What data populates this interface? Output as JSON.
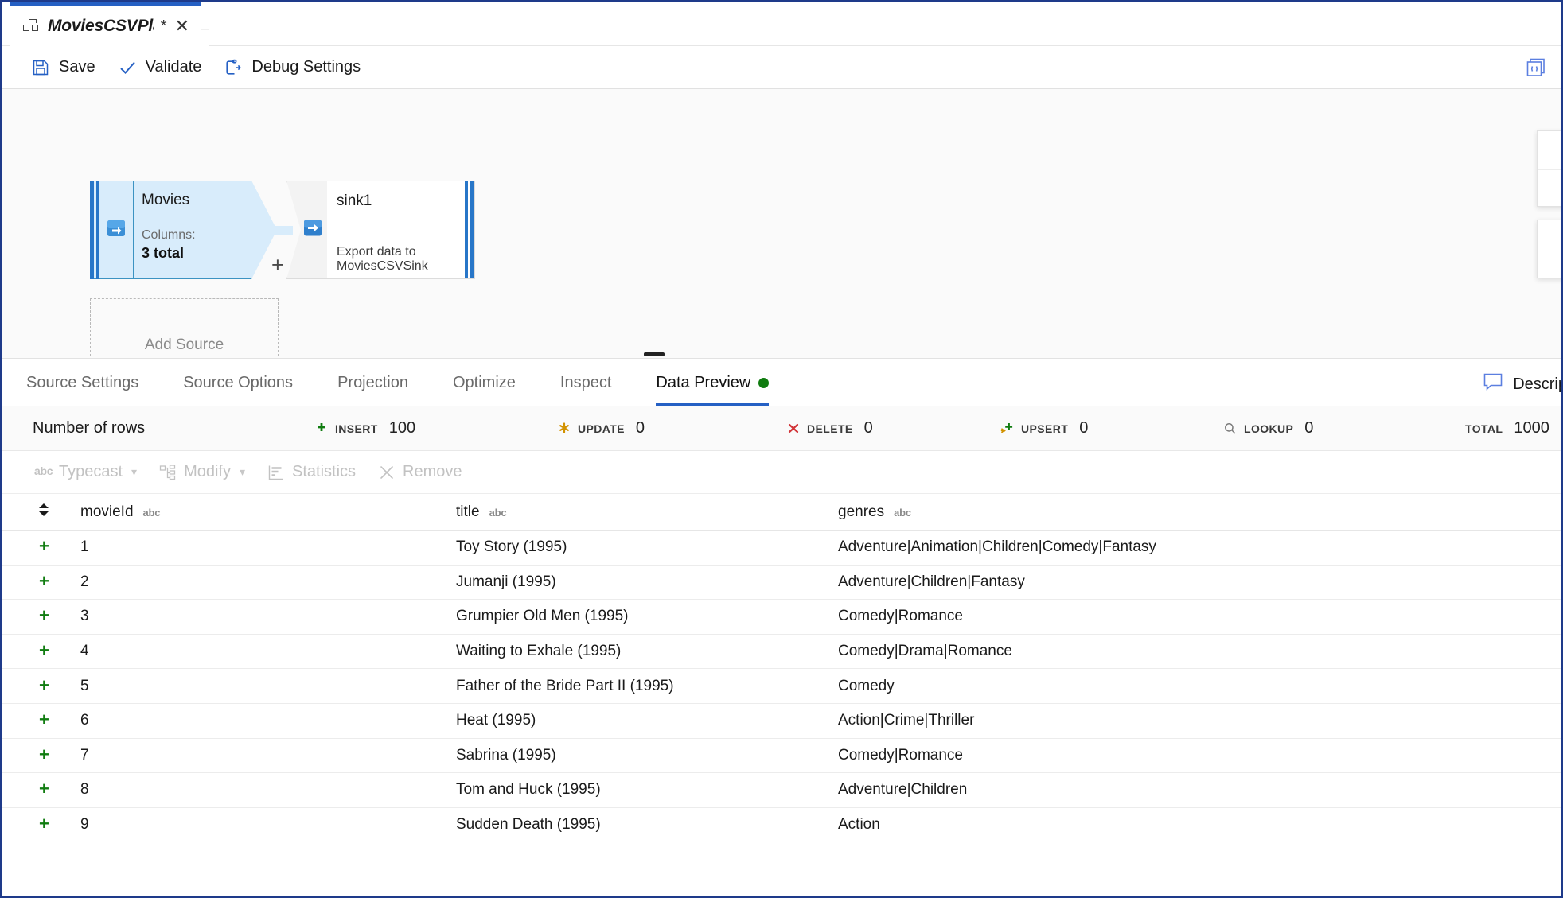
{
  "window": {
    "accent_color": "#2560c4",
    "border_color": "#1e3a8a"
  },
  "tab": {
    "title": "MoviesCSVPla...",
    "dirty_marker": "*",
    "close_label": "✕",
    "tooltip": "MoviesCSVPlayground",
    "icon": "dataflow-icon"
  },
  "command_bar": {
    "buttons": [
      {
        "label": "Save",
        "icon": "save-icon"
      },
      {
        "label": "Validate",
        "icon": "checkmark-icon"
      },
      {
        "label": "Debug Settings",
        "icon": "debug-settings-icon"
      }
    ],
    "code_button_icon": "code-brackets-icon"
  },
  "canvas": {
    "source_node": {
      "name": "Movies",
      "sub_label": "Columns:",
      "sub_value": "3 total",
      "icon": "source-arrow-icon",
      "add_handle": "+"
    },
    "sink_node": {
      "name": "sink1",
      "description": "Export data to MoviesCSVSink",
      "icon": "sink-arrow-icon"
    },
    "add_source_label": "Add Source"
  },
  "bottom_tabs": {
    "items": [
      {
        "label": "Source Settings",
        "active": false
      },
      {
        "label": "Source Options",
        "active": false
      },
      {
        "label": "Projection",
        "active": false
      },
      {
        "label": "Optimize",
        "active": false
      },
      {
        "label": "Inspect",
        "active": false
      },
      {
        "label": "Data Preview",
        "active": true,
        "status_dot_color": "#107c10"
      }
    ],
    "description_button": {
      "label": "Descrip",
      "icon": "comment-icon"
    }
  },
  "stats": {
    "rows_label": "Number of rows",
    "items": [
      {
        "name": "INSERT",
        "value": "100",
        "icon": "plus-icon",
        "color": "#107c10"
      },
      {
        "name": "UPDATE",
        "value": "0",
        "icon": "asterisk-icon",
        "color": "#d29200"
      },
      {
        "name": "DELETE",
        "value": "0",
        "icon": "cross-icon",
        "color": "#d13438"
      },
      {
        "name": "UPSERT",
        "value": "0",
        "icon": "upsert-icon",
        "color": "#107c10"
      },
      {
        "name": "LOOKUP",
        "value": "0",
        "icon": "search-icon",
        "color": "#7a7a7a"
      },
      {
        "name": "TOTAL",
        "value": "1000",
        "icon": "none",
        "color": "#3a3a3a"
      }
    ]
  },
  "column_toolbar": {
    "buttons": [
      {
        "label": "Typecast",
        "icon": "abc-icon",
        "caret": true
      },
      {
        "label": "Modify",
        "icon": "modify-icon",
        "caret": true
      },
      {
        "label": "Statistics",
        "icon": "statistics-icon",
        "caret": false
      },
      {
        "label": "Remove",
        "icon": "close-icon",
        "caret": false
      }
    ]
  },
  "grid": {
    "columns": [
      {
        "label": "movieId",
        "type": "abc"
      },
      {
        "label": "title",
        "type": "abc"
      },
      {
        "label": "genres",
        "type": "abc"
      }
    ],
    "row_marker": "+",
    "rows": [
      {
        "movieId": "1",
        "title": "Toy Story (1995)",
        "genres": "Adventure|Animation|Children|Comedy|Fantasy"
      },
      {
        "movieId": "2",
        "title": "Jumanji (1995)",
        "genres": "Adventure|Children|Fantasy"
      },
      {
        "movieId": "3",
        "title": "Grumpier Old Men (1995)",
        "genres": "Comedy|Romance"
      },
      {
        "movieId": "4",
        "title": "Waiting to Exhale (1995)",
        "genres": "Comedy|Drama|Romance"
      },
      {
        "movieId": "5",
        "title": "Father of the Bride Part II (1995)",
        "genres": "Comedy"
      },
      {
        "movieId": "6",
        "title": "Heat (1995)",
        "genres": "Action|Crime|Thriller"
      },
      {
        "movieId": "7",
        "title": "Sabrina (1995)",
        "genres": "Comedy|Romance"
      },
      {
        "movieId": "8",
        "title": "Tom and Huck (1995)",
        "genres": "Adventure|Children"
      },
      {
        "movieId": "9",
        "title": "Sudden Death (1995)",
        "genres": "Action"
      }
    ]
  }
}
